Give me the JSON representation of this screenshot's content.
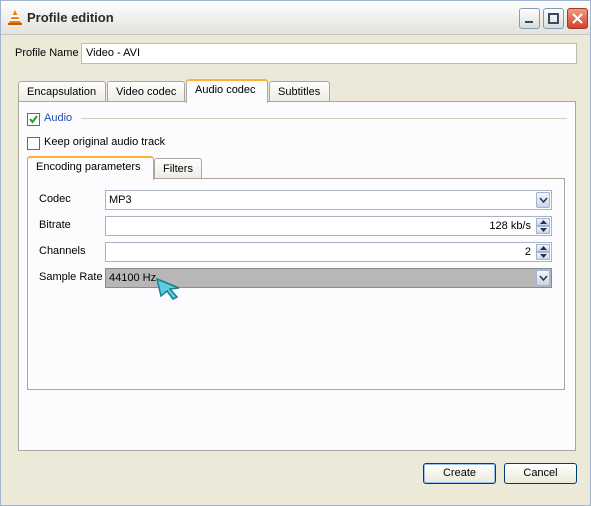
{
  "window": {
    "title": "Profile edition"
  },
  "profile": {
    "name_label": "Profile Name",
    "name_value": "Video - AVI"
  },
  "tabs": [
    {
      "label": "Encapsulation",
      "active": false
    },
    {
      "label": "Video codec",
      "active": false
    },
    {
      "label": "Audio codec",
      "active": true
    },
    {
      "label": "Subtitles",
      "active": false
    }
  ],
  "audio": {
    "enabled_label": "Audio",
    "enabled_checked": true,
    "keep_original_label": "Keep original audio track",
    "keep_original_checked": false
  },
  "subtabs": [
    {
      "label": "Encoding parameters",
      "active": true
    },
    {
      "label": "Filters",
      "active": false
    }
  ],
  "fields": {
    "codec": {
      "label": "Codec",
      "value": "MP3"
    },
    "bitrate": {
      "label": "Bitrate",
      "value": "128 kb/s"
    },
    "channels": {
      "label": "Channels",
      "value": "2"
    },
    "sample_rate": {
      "label": "Sample Rate",
      "value": "44100 Hz"
    }
  },
  "buttons": {
    "create": "Create",
    "cancel": "Cancel"
  },
  "colors": {
    "accent_tab": "#ffb031",
    "checkbox_check": "#21a121",
    "window_bg": "#ece9d8"
  }
}
